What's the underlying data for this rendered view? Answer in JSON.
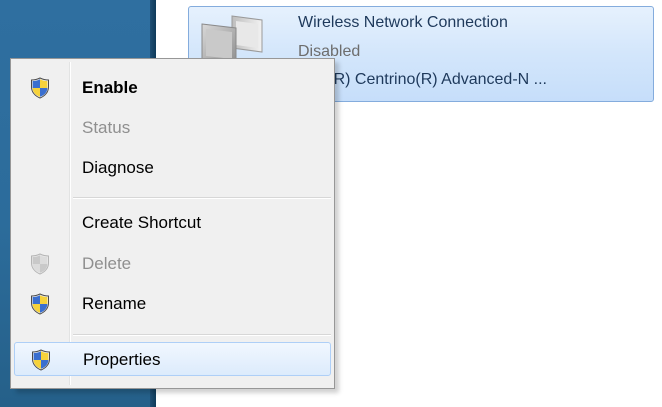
{
  "adapter": {
    "name": "Wireless Network Connection",
    "status": "Disabled",
    "device": "Intel(R) Centrino(R) Advanced-N ..."
  },
  "context_menu": {
    "items": [
      {
        "label": "Enable",
        "icon": "shield-uac-icon",
        "bold": true,
        "enabled": true
      },
      {
        "label": "Status",
        "icon": null,
        "bold": false,
        "enabled": false
      },
      {
        "label": "Diagnose",
        "icon": null,
        "bold": false,
        "enabled": true
      },
      {
        "label": "Create Shortcut",
        "icon": null,
        "bold": false,
        "enabled": true
      },
      {
        "label": "Delete",
        "icon": "shield-uac-icon",
        "bold": false,
        "enabled": false
      },
      {
        "label": "Rename",
        "icon": "shield-uac-icon",
        "bold": false,
        "enabled": true
      },
      {
        "label": "Properties",
        "icon": "shield-uac-icon",
        "bold": false,
        "enabled": true,
        "hovered": true
      }
    ]
  },
  "colors": {
    "left_pane": "#2f6fa0",
    "tile_border": "#84acdd",
    "tile_fill": "#d3e6fb",
    "menu_background": "#f0f0f0",
    "disabled_text": "#8f8f8f"
  }
}
